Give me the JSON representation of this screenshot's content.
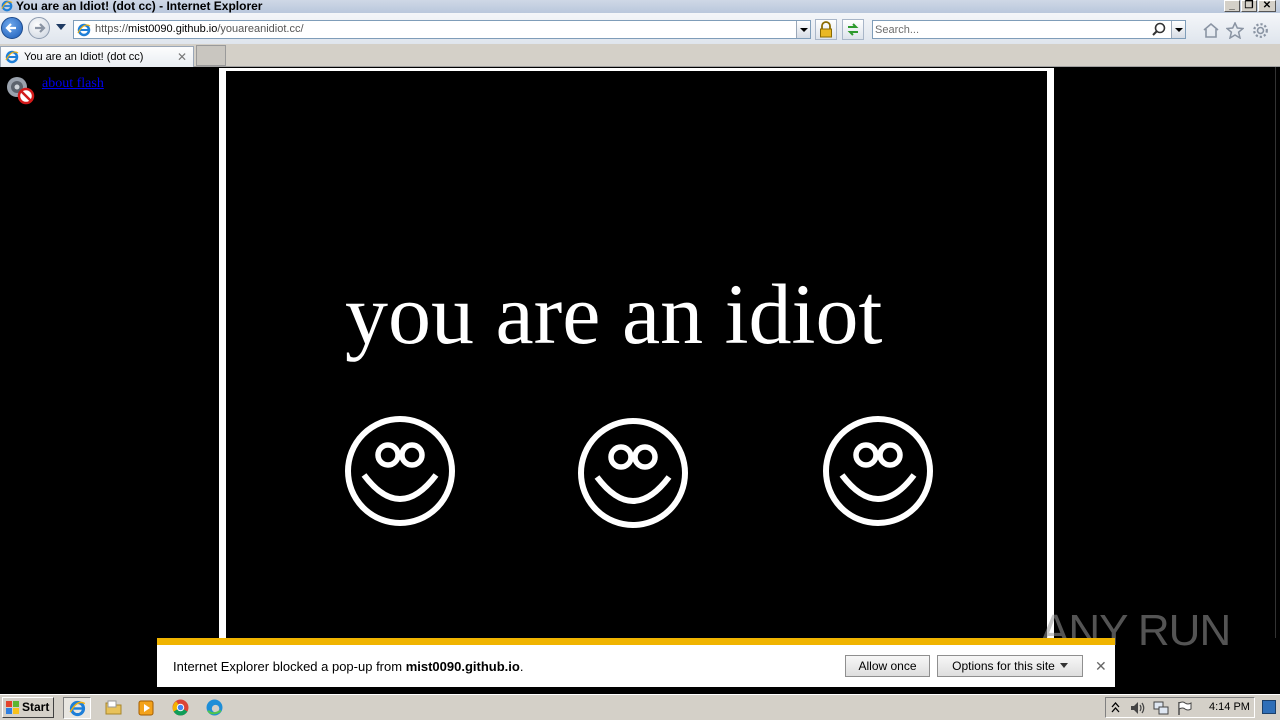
{
  "window": {
    "title": "You are an Idiot! (dot cc) - Internet Explorer",
    "controls": [
      "minimize",
      "restore",
      "close"
    ]
  },
  "navbar": {
    "url_scheme": "https://",
    "url_host": "mist0090.github.io",
    "url_path": "/youareanidiot.cc/",
    "search_placeholder": "Search..."
  },
  "tabs": [
    {
      "label": "You are an Idiot! (dot cc)"
    }
  ],
  "content": {
    "flash_link": "about flash",
    "headline": "you are an idiot",
    "smiley_count": 3,
    "colors": {
      "background": "#000000",
      "foreground": "#ffffff"
    }
  },
  "notification": {
    "message_prefix": "Internet Explorer blocked a pop-up from ",
    "domain": "mist0090.github.io",
    "message_suffix": ".",
    "allow_label": "Allow once",
    "options_label": "Options for this site",
    "accent_color": "#f0b400"
  },
  "watermark": {
    "text": "ANY RUN"
  },
  "taskbar": {
    "start_label": "Start",
    "apps": [
      "internet-explorer",
      "file-explorer",
      "media-player",
      "chrome",
      "edge"
    ],
    "clock": "4:14 PM"
  }
}
